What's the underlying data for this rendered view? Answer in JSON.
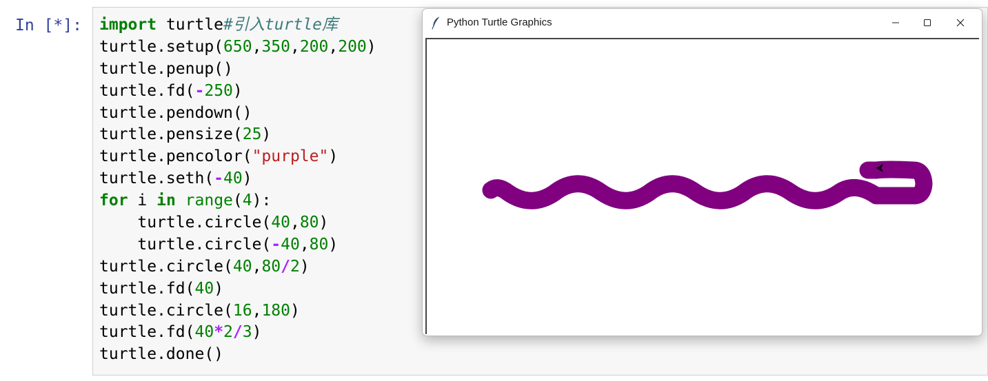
{
  "cell": {
    "prompt": "In [*]:",
    "code_lines": [
      [
        {
          "t": "import",
          "c": "kw"
        },
        {
          "t": " turtle"
        },
        {
          "t": "#引入turtle库",
          "c": "cm"
        }
      ],
      [
        {
          "t": "turtle.setup("
        },
        {
          "t": "650",
          "c": "num"
        },
        {
          "t": ","
        },
        {
          "t": "350",
          "c": "num"
        },
        {
          "t": ","
        },
        {
          "t": "200",
          "c": "num"
        },
        {
          "t": ","
        },
        {
          "t": "200",
          "c": "num"
        },
        {
          "t": ")"
        }
      ],
      [
        {
          "t": "turtle.penup()"
        }
      ],
      [
        {
          "t": "turtle.fd("
        },
        {
          "t": "-",
          "c": "op"
        },
        {
          "t": "250",
          "c": "num"
        },
        {
          "t": ")"
        }
      ],
      [
        {
          "t": "turtle.pendown()"
        }
      ],
      [
        {
          "t": "turtle.pensize("
        },
        {
          "t": "25",
          "c": "num"
        },
        {
          "t": ")"
        }
      ],
      [
        {
          "t": "turtle.pencolor("
        },
        {
          "t": "\"purple\"",
          "c": "str"
        },
        {
          "t": ")"
        }
      ],
      [
        {
          "t": "turtle.seth("
        },
        {
          "t": "-",
          "c": "op"
        },
        {
          "t": "40",
          "c": "num"
        },
        {
          "t": ")"
        }
      ],
      [
        {
          "t": "for",
          "c": "kw"
        },
        {
          "t": " i "
        },
        {
          "t": "in",
          "c": "kw"
        },
        {
          "t": " "
        },
        {
          "t": "range",
          "c": "bi"
        },
        {
          "t": "("
        },
        {
          "t": "4",
          "c": "num"
        },
        {
          "t": "):"
        }
      ],
      [
        {
          "t": "    turtle.circle("
        },
        {
          "t": "40",
          "c": "num"
        },
        {
          "t": ","
        },
        {
          "t": "80",
          "c": "num"
        },
        {
          "t": ")"
        }
      ],
      [
        {
          "t": "    turtle.circle("
        },
        {
          "t": "-",
          "c": "op"
        },
        {
          "t": "40",
          "c": "num"
        },
        {
          "t": ","
        },
        {
          "t": "80",
          "c": "num"
        },
        {
          "t": ")"
        }
      ],
      [
        {
          "t": "turtle.circle("
        },
        {
          "t": "40",
          "c": "num"
        },
        {
          "t": ","
        },
        {
          "t": "80",
          "c": "num"
        },
        {
          "t": "/",
          "c": "op"
        },
        {
          "t": "2",
          "c": "num"
        },
        {
          "t": ")"
        }
      ],
      [
        {
          "t": "turtle.fd("
        },
        {
          "t": "40",
          "c": "num"
        },
        {
          "t": ")"
        }
      ],
      [
        {
          "t": "turtle.circle("
        },
        {
          "t": "16",
          "c": "num"
        },
        {
          "t": ","
        },
        {
          "t": "180",
          "c": "num"
        },
        {
          "t": ")"
        }
      ],
      [
        {
          "t": "turtle.fd("
        },
        {
          "t": "40",
          "c": "num"
        },
        {
          "t": "*",
          "c": "op"
        },
        {
          "t": "2",
          "c": "num"
        },
        {
          "t": "/",
          "c": "op"
        },
        {
          "t": "3",
          "c": "num"
        },
        {
          "t": ")"
        }
      ],
      [
        {
          "t": "turtle.done()"
        }
      ]
    ]
  },
  "turtle_window": {
    "title": "Python Turtle Graphics",
    "icon": "feather-icon",
    "controls": [
      "minimize-icon",
      "maximize-icon",
      "close-icon"
    ],
    "pen_color": "#800080",
    "turtle_color": "#000000"
  }
}
